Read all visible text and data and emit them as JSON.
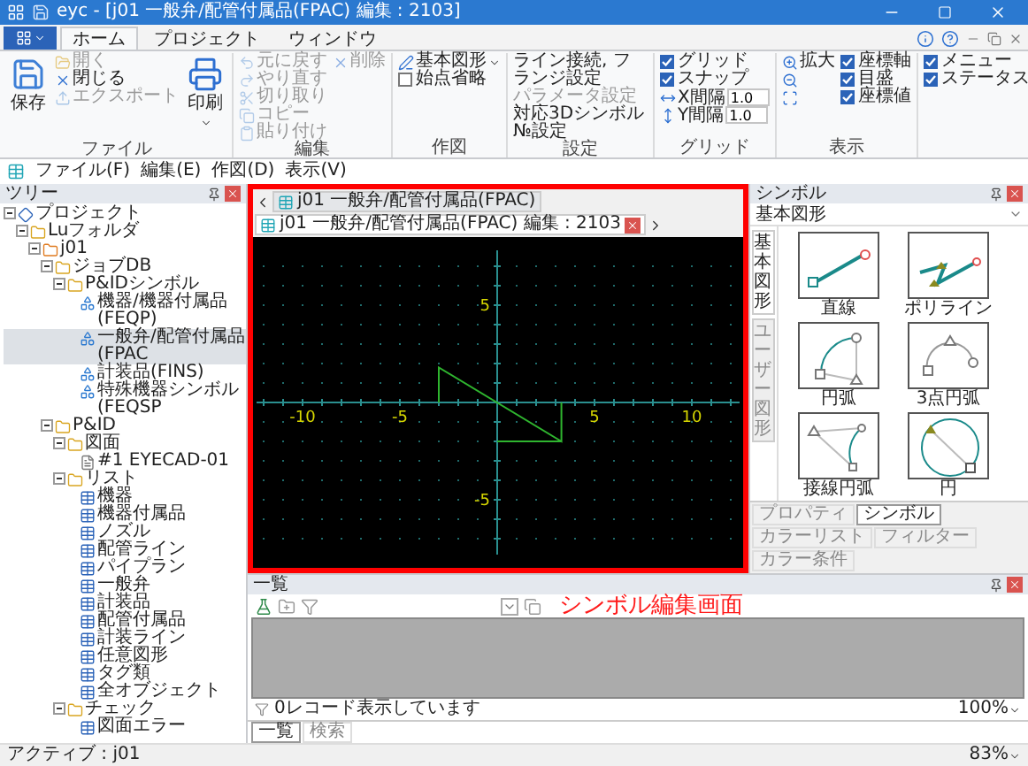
{
  "window": {
    "title": "eyc - [j01 一般弁/配管付属品(FPAC) 編集 : 2103]"
  },
  "ribbon": {
    "tabs": [
      {
        "label": "ホーム",
        "selected": true
      },
      {
        "label": "プロジェクト",
        "selected": false
      },
      {
        "label": "ウィンドウ",
        "selected": false
      }
    ],
    "groups": [
      {
        "label": "ファイル",
        "columns": [
          [
            {
              "kind": "large",
              "label": "保存",
              "disabled": false
            }
          ],
          [
            {
              "kind": "small",
              "label": "開く",
              "disabled": true
            },
            {
              "kind": "small",
              "label": "閉じる",
              "disabled": false
            },
            {
              "kind": "small",
              "label": "エクスポート",
              "disabled": true
            }
          ],
          [
            {
              "kind": "large",
              "label": "印刷",
              "disabled": false,
              "dropdown": true
            }
          ]
        ]
      },
      {
        "label": "編集",
        "columns": [
          [
            {
              "kind": "small",
              "label": "元に戻す",
              "disabled": true
            },
            {
              "kind": "small",
              "label": "やり直す",
              "disabled": true
            },
            {
              "kind": "small",
              "label": "切り取り",
              "disabled": true
            },
            {
              "kind": "small",
              "label": "コピー",
              "disabled": true
            },
            {
              "kind": "small",
              "label": "貼り付け",
              "disabled": true
            }
          ],
          [
            {
              "kind": "small",
              "label": "削除",
              "disabled": true
            }
          ]
        ]
      },
      {
        "label": "作図",
        "columns": [
          [
            {
              "kind": "small",
              "label": "基本図形",
              "disabled": false,
              "dropdown": true
            },
            {
              "kind": "check",
              "label": "始点省略",
              "checked": false
            }
          ]
        ]
      },
      {
        "label": "設定",
        "columns": [
          [
            {
              "kind": "text",
              "label": "ライン接続, フランジ設定",
              "disabled": false
            },
            {
              "kind": "text",
              "label": "パラメータ設定",
              "disabled": true
            },
            {
              "kind": "text",
              "label": "対応3Dシンボル№設定",
              "disabled": false
            }
          ]
        ]
      },
      {
        "label": "グリッド",
        "columns": [
          [
            {
              "kind": "check",
              "label": "グリッド",
              "checked": true
            },
            {
              "kind": "check",
              "label": "スナップ",
              "checked": true
            },
            {
              "kind": "spin",
              "label": "X間隔",
              "value": "1.0"
            },
            {
              "kind": "spin",
              "label": "Y間隔",
              "value": "1.0"
            }
          ]
        ]
      },
      {
        "label": "表示",
        "columns": [
          [
            {
              "kind": "small",
              "label": "拡大",
              "disabled": false
            },
            {
              "kind": "icon",
              "disabled": false
            },
            {
              "kind": "icon",
              "disabled": false
            }
          ],
          [
            {
              "kind": "check",
              "label": "座標軸",
              "checked": true
            },
            {
              "kind": "check",
              "label": "目盛",
              "checked": true
            },
            {
              "kind": "check",
              "label": "座標値",
              "checked": true
            }
          ]
        ]
      },
      {
        "columns": [
          [
            {
              "kind": "check",
              "label": "メニュー",
              "checked": true
            },
            {
              "kind": "check",
              "label": "ステータス",
              "checked": true
            }
          ]
        ]
      }
    ]
  },
  "document_menu": [
    "ファイル(F)",
    "編集(E)",
    "作図(D)",
    "表示(V)"
  ],
  "tree": {
    "title": "ツリー",
    "items": [
      {
        "kind": "project",
        "label": "プロジェクト",
        "selected": false,
        "expanded": true,
        "children": [
          {
            "kind": "folder",
            "label": "Luフォルダ",
            "selected": false,
            "expanded": true,
            "children": [
              {
                "kind": "job",
                "label": "j01",
                "selected": false,
                "expanded": true,
                "children": [
                  {
                    "kind": "folder",
                    "label": "ジョブDB",
                    "selected": false,
                    "expanded": true,
                    "children": [
                      {
                        "kind": "folder",
                        "label": "P&IDシンボル",
                        "selected": false,
                        "expanded": true,
                        "children": [
                          {
                            "kind": "symbol",
                            "label": "機器/機器付属品(FEQP)",
                            "selected": false
                          },
                          {
                            "kind": "symbol",
                            "label": "一般弁/配管付属品(FPAC",
                            "selected": true
                          },
                          {
                            "kind": "symbol",
                            "label": "計装品(FINS)",
                            "selected": false
                          },
                          {
                            "kind": "symbol",
                            "label": "特殊機器シンボル(FEQSP",
                            "selected": false
                          }
                        ]
                      }
                    ]
                  },
                  {
                    "kind": "folder",
                    "label": "P&ID",
                    "selected": false,
                    "expanded": true,
                    "children": [
                      {
                        "kind": "folder",
                        "label": "図面",
                        "selected": false,
                        "expanded": true,
                        "children": [
                          {
                            "kind": "drawing",
                            "label": "#1 EYECAD-01",
                            "selected": false
                          }
                        ]
                      },
                      {
                        "kind": "folder",
                        "label": "リスト",
                        "selected": false,
                        "expanded": true,
                        "children": [
                          {
                            "kind": "list",
                            "label": "機器",
                            "selected": false
                          },
                          {
                            "kind": "list",
                            "label": "機器付属品",
                            "selected": false
                          },
                          {
                            "kind": "list",
                            "label": "ノズル",
                            "selected": false
                          },
                          {
                            "kind": "list",
                            "label": "配管ライン",
                            "selected": false
                          },
                          {
                            "kind": "list",
                            "label": "パイプラン",
                            "selected": false
                          },
                          {
                            "kind": "list",
                            "label": "一般弁",
                            "selected": false
                          },
                          {
                            "kind": "list",
                            "label": "計装品",
                            "selected": false
                          },
                          {
                            "kind": "list",
                            "label": "配管付属品",
                            "selected": false
                          },
                          {
                            "kind": "list",
                            "label": "計装ライン",
                            "selected": false
                          },
                          {
                            "kind": "list",
                            "label": "任意図形",
                            "selected": false
                          },
                          {
                            "kind": "list",
                            "label": "タグ類",
                            "selected": false
                          },
                          {
                            "kind": "list",
                            "label": "全オブジェクト",
                            "selected": false
                          }
                        ]
                      },
                      {
                        "kind": "folder",
                        "label": "チェック",
                        "selected": false,
                        "expanded": true,
                        "children": [
                          {
                            "kind": "list",
                            "label": "図面エラー",
                            "selected": false
                          }
                        ]
                      }
                    ]
                  }
                ]
              }
            ]
          }
        ]
      }
    ]
  },
  "editor": {
    "tabs": [
      {
        "label": "j01 一般弁/配管付属品(FPAC)",
        "selected": false
      },
      {
        "label": "j01 一般弁/配管付属品(FPAC) 編集 : 2103",
        "selected": true
      }
    ],
    "x_labels": [
      "-10",
      "-5",
      "5",
      "10"
    ],
    "y_labels": [
      "5",
      "-5"
    ]
  },
  "annotation": "シンボル編集画面",
  "symbol_panel": {
    "title": "シンボル",
    "category": "基本図形",
    "side_tabs": [
      {
        "label": "基本図形",
        "selected": true
      },
      {
        "label": "ユーザー図形",
        "selected": false
      }
    ],
    "shapes": [
      "直線",
      "ポリライン",
      "円弧",
      "3点円弧",
      "接線円弧",
      "円"
    ],
    "bottom_tabs": [
      {
        "label": "プロパティ",
        "selected": false
      },
      {
        "label": "シンボル",
        "selected": true
      },
      {
        "label": "カラーリスト",
        "selected": false
      },
      {
        "label": "フィルター",
        "selected": false
      },
      {
        "label": "カラー条件",
        "selected": false
      }
    ]
  },
  "list_panel": {
    "title": "一覧",
    "record_count": "0レコード表示しています",
    "zoom": "100%",
    "tabs": [
      {
        "label": "一覧",
        "selected": true
      },
      {
        "label": "検索",
        "selected": false
      }
    ]
  },
  "status_bar": {
    "active": "アクティブ : j01",
    "zoom": "83%"
  }
}
